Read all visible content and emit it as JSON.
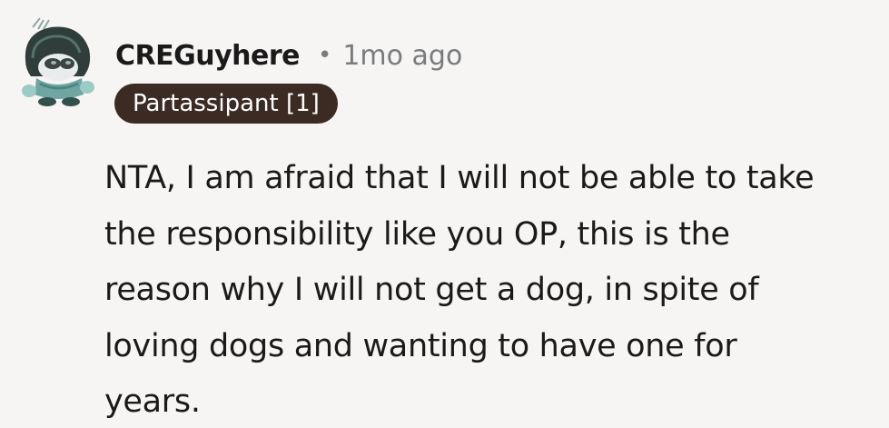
{
  "comment": {
    "author": "CREGuyhere",
    "separator": "•",
    "timestamp": "1mo ago",
    "flair": "Partassipant [1]",
    "avatar_icon": "snoo-avatar-icon",
    "body": "NTA, I am afraid that I will not be able to take\nthe responsibility like you OP, this is the\nreason why I will not get a dog, in spite of\nloving dogs and wanting to have one for\nyears."
  },
  "colors": {
    "background": "#f7f5f3",
    "text": "#1a1a1b",
    "meta": "#787c7e",
    "flair_bg": "#3b2b22",
    "flair_text": "#ffffff"
  }
}
